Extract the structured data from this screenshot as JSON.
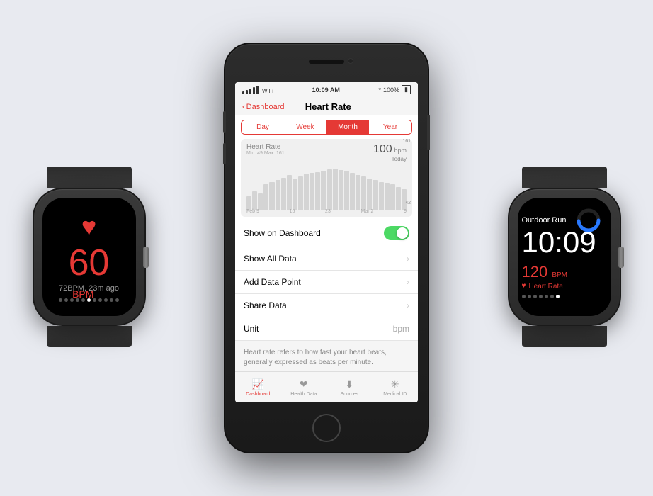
{
  "background_color": "#e8eaf0",
  "watch_left": {
    "bpm": "60",
    "bpm_label": "BPM",
    "sub_text": "72BPM, 23m ago",
    "dots": [
      false,
      false,
      false,
      false,
      false,
      true,
      false,
      false,
      false,
      false,
      false
    ]
  },
  "iphone": {
    "status_bar": {
      "signal": "●●●●●",
      "wifi": "WiFi",
      "time": "10:09 AM",
      "bluetooth": "BT",
      "battery": "100%"
    },
    "nav": {
      "back_label": "Dashboard",
      "title": "Heart Rate"
    },
    "tabs": [
      "Day",
      "Week",
      "Month",
      "Year"
    ],
    "active_tab": "Month",
    "chart": {
      "title": "Heart Rate",
      "min_label": "Min: 49  Max: 161",
      "value": "100",
      "unit": "bpm",
      "period": "Today",
      "high": "161",
      "low": "42",
      "dates": [
        "Feb 9",
        "16",
        "23",
        "Mar 2",
        "9"
      ]
    },
    "list_rows": [
      {
        "label": "Show on Dashboard",
        "type": "toggle",
        "toggle_on": true
      },
      {
        "label": "Show All Data",
        "type": "chevron"
      },
      {
        "label": "Add Data Point",
        "type": "chevron"
      },
      {
        "label": "Share Data",
        "type": "chevron"
      },
      {
        "label": "Unit",
        "type": "value",
        "value": "bpm"
      }
    ],
    "description": "Heart rate refers to how fast your heart beats, generally expressed as beats per minute.",
    "tab_bar": [
      {
        "label": "Dashboard",
        "icon": "📈",
        "active": true
      },
      {
        "label": "Health Data",
        "icon": "❤️",
        "active": false
      },
      {
        "label": "Sources",
        "icon": "⬇",
        "active": false
      },
      {
        "label": "Medical ID",
        "icon": "✳",
        "active": false
      }
    ]
  },
  "watch_right": {
    "title": "Outdoor Run",
    "time": "10:09",
    "bpm": "120",
    "bpm_label": "BPM",
    "heart_rate_label": "Heart Rate",
    "dots": [
      false,
      false,
      false,
      false,
      false,
      false,
      true
    ]
  }
}
